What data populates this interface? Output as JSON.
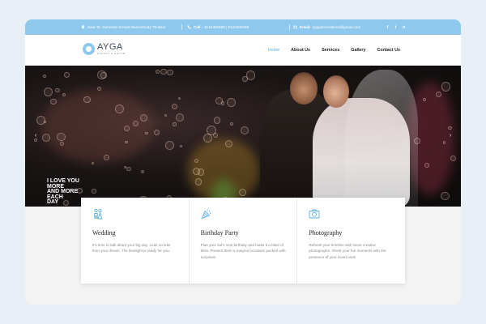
{
  "topbar": {
    "address": "Near St. Gemmas School Mannuthody Thrissur",
    "call_label": "Call :",
    "call_value": "9144300488 | 9144300488",
    "email_label": "Email:",
    "email_value": "aygadecorations@gmail.com",
    "social": [
      "f",
      "t",
      "o"
    ]
  },
  "brand": {
    "name": "AYGA",
    "tagline": "EVENTS & DECOR"
  },
  "nav": {
    "items": [
      "Home",
      "About Us",
      "Services",
      "Gallery",
      "Contact Us"
    ],
    "active": "Home"
  },
  "hero": {
    "caption_lines": [
      "I LOVE YOU",
      "MORE",
      "AND MORE",
      "EACH",
      "DAY"
    ],
    "prev_icon": "chevron-left-icon",
    "next_icon": "chevron-right-icon"
  },
  "cards": [
    {
      "icon": "wedding-icon",
      "title": "Wedding",
      "text": "It's time to talk about your big day. Look no less than your dream. The limelight is ready for you."
    },
    {
      "icon": "party-icon",
      "title": "Birthday Party",
      "text": "Plan your kid's next birthday and make it a blast of bliss. Present them a magical occasion packed with surprises"
    },
    {
      "icon": "camera-icon",
      "title": "Photography",
      "text": "Refresh your timeline with some creative photographs. Shoot your fun moments with the presence of your loved ones"
    }
  ],
  "colors": {
    "accent": "#8ec8ec",
    "link_active": "#5aaee0",
    "background": "#e8eff7"
  }
}
